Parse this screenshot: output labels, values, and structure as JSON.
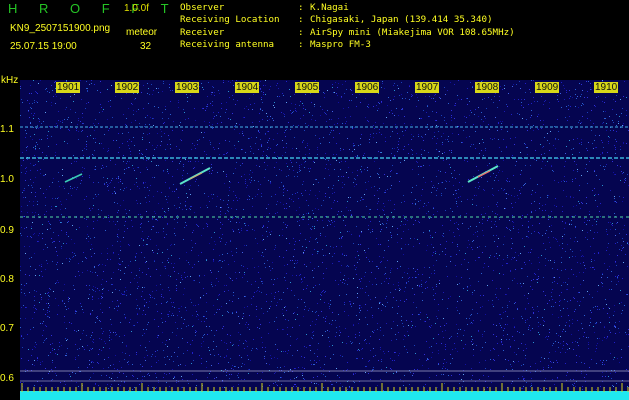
{
  "header": {
    "title": "H R O F F T",
    "version": "1.0.0f",
    "filename": "KN9_2507151900.png",
    "mode": "meteor",
    "datetime": "25.07.15 19:00",
    "count": "32"
  },
  "meta": [
    {
      "key": "Observer",
      "value": "K.Nagai"
    },
    {
      "key": "Receiving Location",
      "value": "Chigasaki, Japan (139.414 35.340)"
    },
    {
      "key": "Receiver",
      "value": "AirSpy mini (Miakejima VOR 108.65MHz)"
    },
    {
      "key": "Receiving antenna",
      "value": "Maspro FM-3"
    }
  ],
  "axis": {
    "ylabel": "kHz",
    "yticks": [
      "1.1",
      "1.0",
      "0.9",
      "0.8",
      "0.7",
      "0.6"
    ],
    "xticks": [
      "1901",
      "1902",
      "1903",
      "1904",
      "1905",
      "1906",
      "1907",
      "1908",
      "1909",
      "1910"
    ]
  },
  "colors": {
    "background": "#000000",
    "noise_base": "#0a0a8a",
    "carrier": "#30c0e0",
    "label": "#ffff22",
    "title": "#25c425",
    "scale_band": "#d8d818"
  }
}
